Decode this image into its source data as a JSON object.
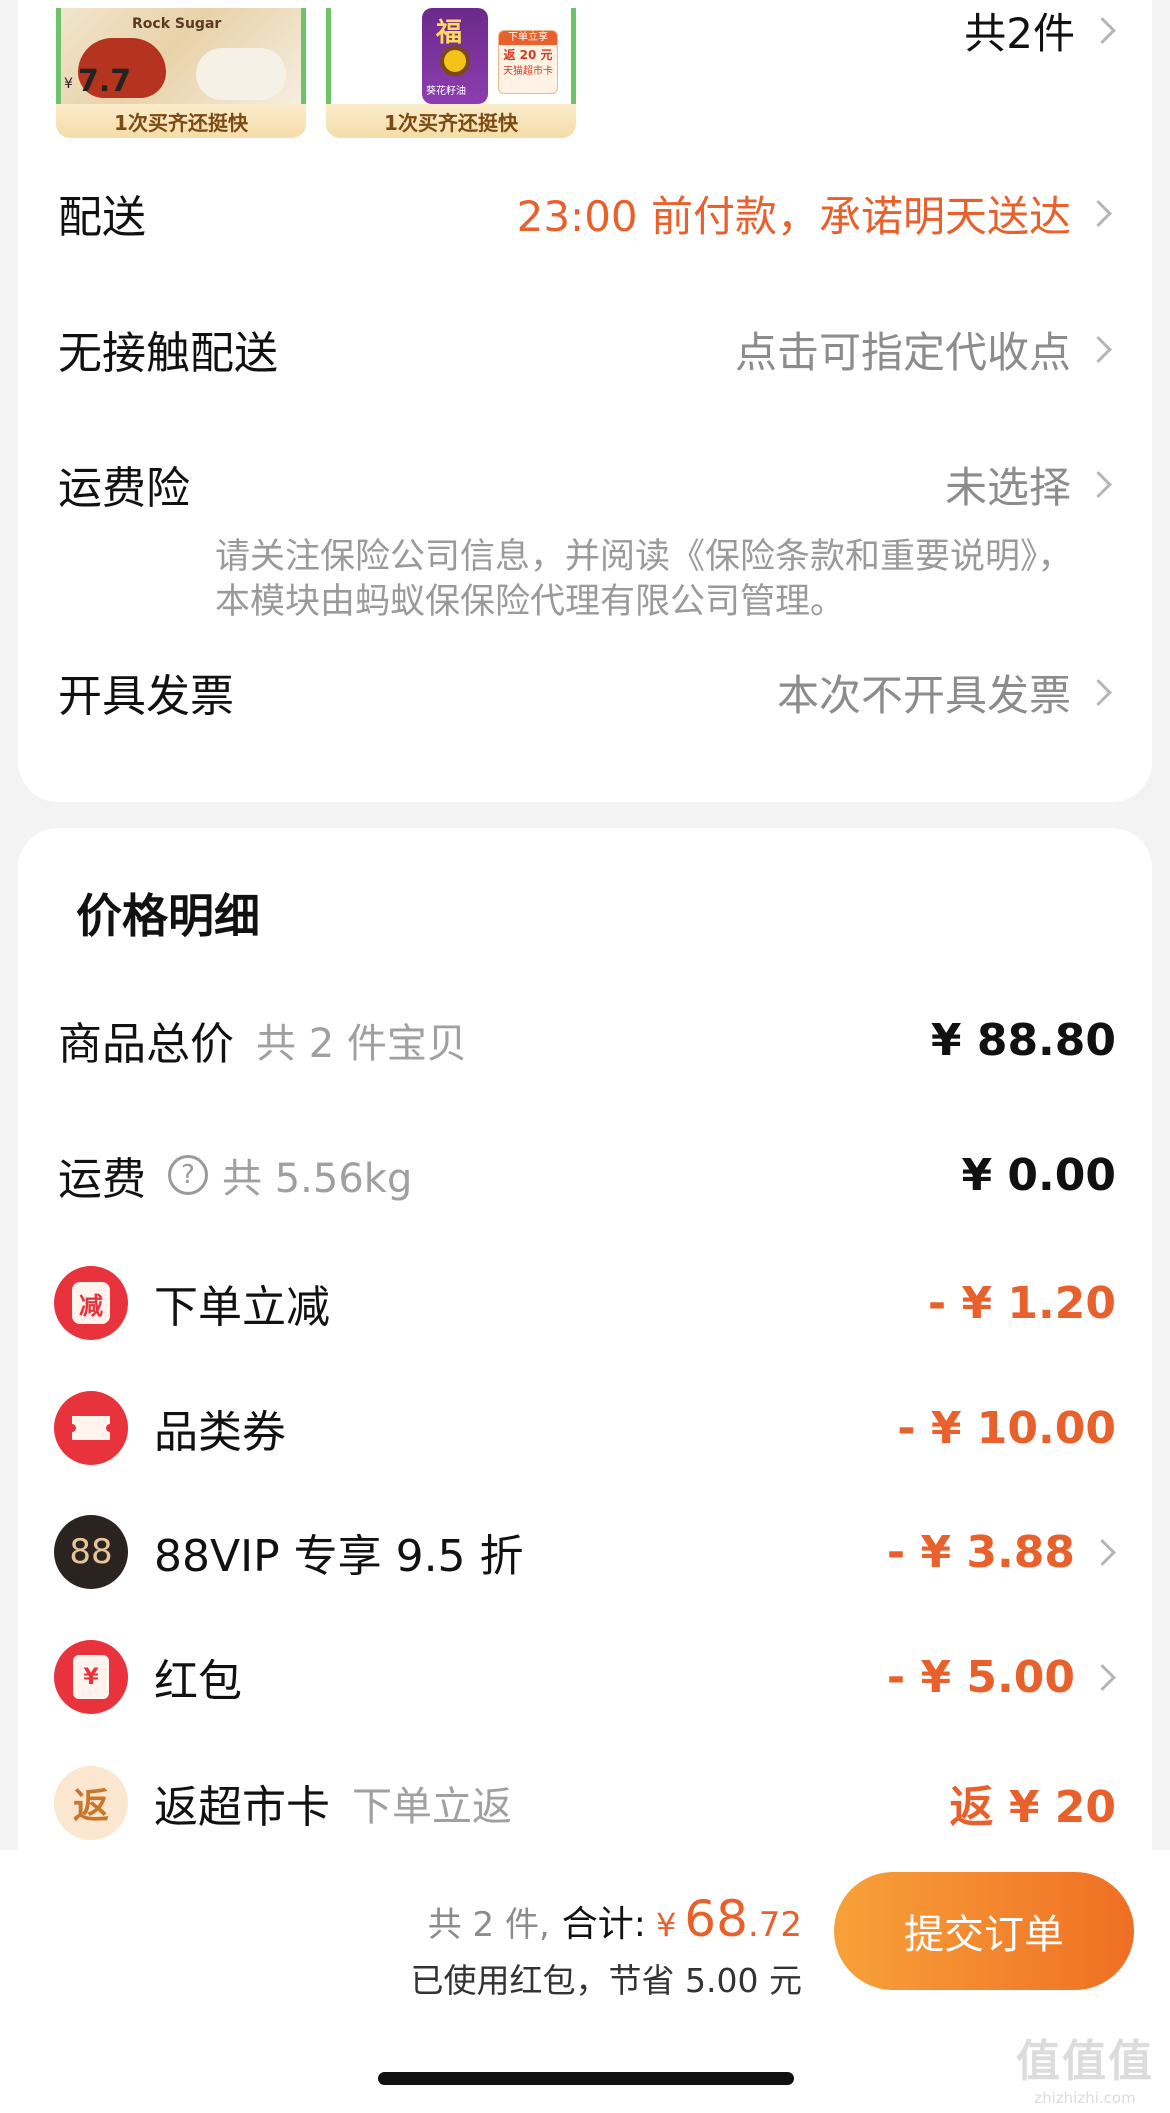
{
  "top_bar": {
    "count_label": "共2件"
  },
  "products": [
    {
      "name_text": "Rock Sugar",
      "price": "7.7",
      "price_prefix": "¥",
      "tag": "1次买齐还挺快"
    },
    {
      "brand_char": "福",
      "product_text": "葵花籽油",
      "promo_title": "下单立享",
      "promo_text": "返 20 元",
      "promo_sub": "天猫超市卡",
      "tag": "1次买齐还挺快"
    }
  ],
  "order_rows": {
    "delivery": {
      "label": "配送",
      "value": "23:00 前付款，承诺明天送达"
    },
    "contactless": {
      "label": "无接触配送",
      "value": "点击可指定代收点"
    },
    "insurance": {
      "label": "运费险",
      "value": "未选择",
      "note": "请关注保险公司信息，并阅读《保险条款和重要说明》，本模块由蚂蚁保保险代理有限公司管理。"
    },
    "invoice": {
      "label": "开具发票",
      "value": "本次不开具发票"
    }
  },
  "price_detail": {
    "title": "价格明细",
    "goods_total": {
      "label": "商品总价",
      "sub": "共 2 件宝贝",
      "amount": "¥ 88.80"
    },
    "shipping": {
      "label": "运费",
      "help": "?",
      "sub": "共 5.56kg",
      "amount": "¥ 0.00"
    },
    "discounts": [
      {
        "icon_text": "减",
        "label": "下单立减",
        "amount": "- ¥ 1.20"
      },
      {
        "icon_text": "",
        "label": "品类券",
        "amount": "- ¥ 10.00"
      },
      {
        "icon_text": "88",
        "label": "88VIP 专享 9.5 折",
        "amount": "- ¥ 3.88"
      },
      {
        "icon_text": "¥",
        "label": "红包",
        "amount": "- ¥ 5.00"
      },
      {
        "icon_text": "返",
        "label": "返超市卡",
        "sub": "下单立返",
        "amount": "返 ¥ 20"
      }
    ]
  },
  "bottom_bar": {
    "count": "共 2 件,",
    "total_label": "合计:",
    "currency": "¥",
    "total_int": "68",
    "total_dec": ".72",
    "saving": "已使用红包，节省 5.00 元",
    "submit": "提交订单"
  },
  "watermark": {
    "main": "值值值",
    "sub": "zhizhizhi.com"
  },
  "colors": {
    "accent_orange": "#e8612c",
    "red_icon": "#e8333d",
    "vip_dark": "#2a2320",
    "vip_gold": "#e6c59a",
    "submit_start": "#f7a13a",
    "submit_end": "#ef6f23"
  },
  "icons": {
    "chevron": "chevron-right-icon",
    "help": "help-circle-icon",
    "coupon": "ticket-icon",
    "red_packet": "red-packet-icon",
    "supermarket": "return-card-icon"
  }
}
